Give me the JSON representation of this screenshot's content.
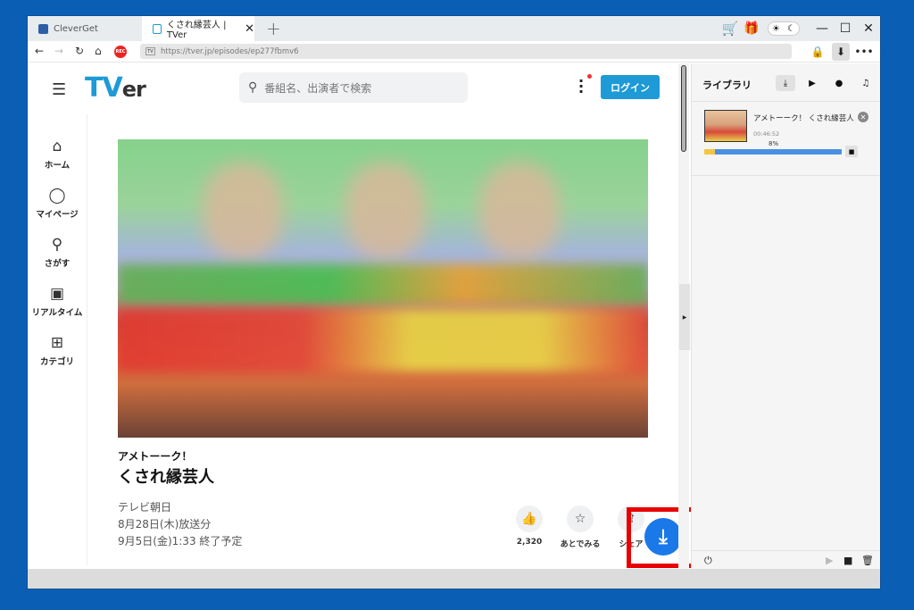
{
  "tabs": [
    {
      "label": "CleverGet",
      "active": false
    },
    {
      "label": "くされ縁芸人 | TVer",
      "active": true
    }
  ],
  "address": {
    "url": "https://tver.jp/episodes/ep277fbmv6",
    "rec_label": "REC"
  },
  "colors": {
    "accent": "#1e9ad6",
    "highlight": "#e80000",
    "fab": "#1a78e8"
  },
  "site": {
    "logo_t": "T",
    "logo_v": "V",
    "logo_er": "er",
    "search_placeholder": "番組名、出演者で検索",
    "login_label": "ログイン"
  },
  "sidenav": [
    {
      "icon": "home-icon",
      "glyph": "⌂",
      "label": "ホーム"
    },
    {
      "icon": "user-icon",
      "glyph": "◯",
      "label": "マイページ"
    },
    {
      "icon": "search-icon",
      "glyph": "⚲",
      "label": "さがす"
    },
    {
      "icon": "tv-icon",
      "glyph": "▣",
      "label": "リアルタイム"
    },
    {
      "icon": "grid-icon",
      "glyph": "⊞",
      "label": "カテゴリ"
    }
  ],
  "episode": {
    "series": "アメトーーク！",
    "title": "くされ縁芸人",
    "channel": "テレビ朝日",
    "aired": "8月28日(木)放送分",
    "ends": "9月5日(金)1:33 終了予定",
    "like_count": "2,320",
    "later_label": "あとでみる",
    "share_label": "シェア"
  },
  "library": {
    "title": "ライブラリ",
    "task": {
      "name": "アメトーーク！ くされ縁芸人",
      "duration": "00:46:52",
      "percent_label": "8%",
      "progress": 0.08
    }
  }
}
